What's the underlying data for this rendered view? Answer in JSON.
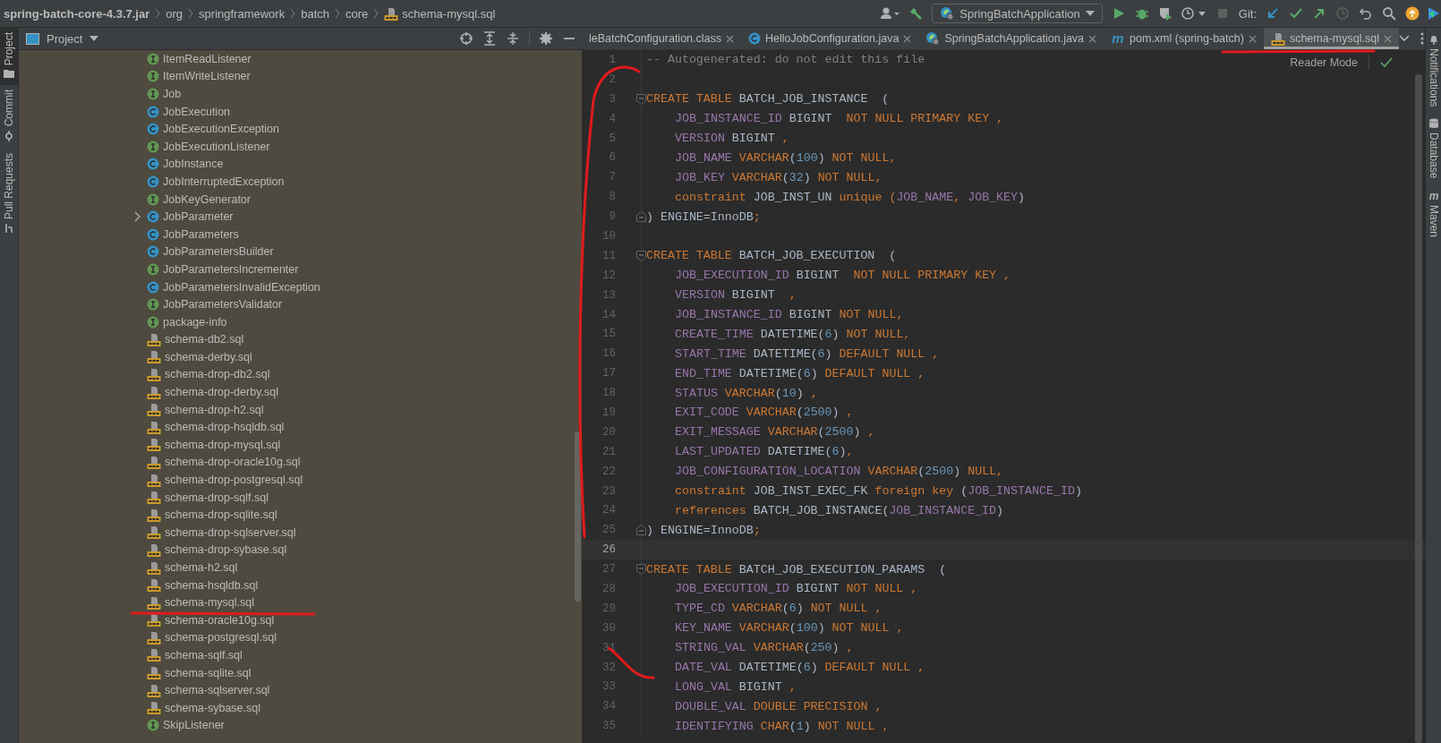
{
  "breadcrumbs": [
    {
      "label": "spring-batch-core-4.3.7.jar",
      "kind": "jar"
    },
    {
      "label": "org",
      "kind": "folder"
    },
    {
      "label": "springframework",
      "kind": "folder"
    },
    {
      "label": "batch",
      "kind": "folder"
    },
    {
      "label": "core",
      "kind": "folder"
    },
    {
      "label": "schema-mysql.sql",
      "kind": "sql"
    }
  ],
  "toolbar": {
    "run_config": "SpringBatchApplication",
    "git_label": "Git:"
  },
  "left_strip": [
    {
      "label": "Project",
      "selected": true
    },
    {
      "label": "Commit",
      "selected": false
    },
    {
      "label": "Pull Requests",
      "selected": false
    }
  ],
  "project_panel": {
    "title": "Project",
    "items": [
      {
        "label": "ItemReadListener",
        "kind": "interface",
        "expandable": false
      },
      {
        "label": "ItemWriteListener",
        "kind": "interface",
        "expandable": false
      },
      {
        "label": "Job",
        "kind": "interface",
        "expandable": false
      },
      {
        "label": "JobExecution",
        "kind": "class",
        "expandable": false
      },
      {
        "label": "JobExecutionException",
        "kind": "class",
        "expandable": false
      },
      {
        "label": "JobExecutionListener",
        "kind": "interface",
        "expandable": false
      },
      {
        "label": "JobInstance",
        "kind": "class",
        "expandable": false
      },
      {
        "label": "JobInterruptedException",
        "kind": "class",
        "expandable": false
      },
      {
        "label": "JobKeyGenerator",
        "kind": "interface",
        "expandable": false
      },
      {
        "label": "JobParameter",
        "kind": "class",
        "expandable": true
      },
      {
        "label": "JobParameters",
        "kind": "class",
        "expandable": false
      },
      {
        "label": "JobParametersBuilder",
        "kind": "class",
        "expandable": false
      },
      {
        "label": "JobParametersIncrementer",
        "kind": "interface",
        "expandable": false
      },
      {
        "label": "JobParametersInvalidException",
        "kind": "class",
        "expandable": false
      },
      {
        "label": "JobParametersValidator",
        "kind": "interface",
        "expandable": false
      },
      {
        "label": "package-info",
        "kind": "interface",
        "expandable": false
      },
      {
        "label": "schema-db2.sql",
        "kind": "sql",
        "expandable": false
      },
      {
        "label": "schema-derby.sql",
        "kind": "sql",
        "expandable": false
      },
      {
        "label": "schema-drop-db2.sql",
        "kind": "sql",
        "expandable": false
      },
      {
        "label": "schema-drop-derby.sql",
        "kind": "sql",
        "expandable": false
      },
      {
        "label": "schema-drop-h2.sql",
        "kind": "sql",
        "expandable": false
      },
      {
        "label": "schema-drop-hsqldb.sql",
        "kind": "sql",
        "expandable": false
      },
      {
        "label": "schema-drop-mysql.sql",
        "kind": "sql",
        "expandable": false
      },
      {
        "label": "schema-drop-oracle10g.sql",
        "kind": "sql",
        "expandable": false
      },
      {
        "label": "schema-drop-postgresql.sql",
        "kind": "sql",
        "expandable": false
      },
      {
        "label": "schema-drop-sqlf.sql",
        "kind": "sql",
        "expandable": false
      },
      {
        "label": "schema-drop-sqlite.sql",
        "kind": "sql",
        "expandable": false
      },
      {
        "label": "schema-drop-sqlserver.sql",
        "kind": "sql",
        "expandable": false
      },
      {
        "label": "schema-drop-sybase.sql",
        "kind": "sql",
        "expandable": false
      },
      {
        "label": "schema-h2.sql",
        "kind": "sql",
        "expandable": false
      },
      {
        "label": "schema-hsqldb.sql",
        "kind": "sql",
        "expandable": false
      },
      {
        "label": "schema-mysql.sql",
        "kind": "sql",
        "expandable": false
      },
      {
        "label": "schema-oracle10g.sql",
        "kind": "sql",
        "expandable": false
      },
      {
        "label": "schema-postgresql.sql",
        "kind": "sql",
        "expandable": false
      },
      {
        "label": "schema-sqlf.sql",
        "kind": "sql",
        "expandable": false
      },
      {
        "label": "schema-sqlite.sql",
        "kind": "sql",
        "expandable": false
      },
      {
        "label": "schema-sqlserver.sql",
        "kind": "sql",
        "expandable": false
      },
      {
        "label": "schema-sybase.sql",
        "kind": "sql",
        "expandable": false
      },
      {
        "label": "SkipListener",
        "kind": "interface",
        "expandable": false
      }
    ]
  },
  "tabs": [
    {
      "label": "leBatchConfiguration.class",
      "kind": "none",
      "selected": false
    },
    {
      "label": "HelloJobConfiguration.java",
      "kind": "class",
      "selected": false
    },
    {
      "label": "SpringBatchApplication.java",
      "kind": "spring",
      "selected": false
    },
    {
      "label": "pom.xml (spring-batch)",
      "kind": "maven",
      "badge": "m",
      "selected": false
    },
    {
      "label": "schema-mysql.sql",
      "kind": "sql",
      "selected": true
    }
  ],
  "editor": {
    "reader_mode": "Reader Mode",
    "lines": [
      {
        "number": "1",
        "current": false,
        "kind": "plain",
        "tokens": [
          {
            "text": "-- Autogenerated: do not edit this file",
            "kind": "comment"
          }
        ]
      },
      {
        "number": "2",
        "current": false,
        "kind": "plain"
      },
      {
        "number": "3",
        "current": false,
        "kind": "fold-start",
        "tokens": [
          {
            "text": "CREATE TABLE ",
            "kind": "keyword"
          },
          {
            "text": "BATCH_JOB_INSTANCE  (",
            "kind": "name"
          }
        ]
      },
      {
        "number": "4",
        "current": false,
        "kind": "field",
        "tokens": [
          {
            "text": "JOB_INSTANCE_ID",
            "kind": "column"
          },
          {
            "text": " BIGINT  ",
            "kind": "name"
          },
          {
            "text": "NOT NULL PRIMARY KEY ,",
            "kind": "keyword"
          }
        ]
      },
      {
        "number": "5",
        "current": false,
        "kind": "field",
        "tokens": [
          {
            "text": "VERSION",
            "kind": "column"
          },
          {
            "text": " BIGINT ",
            "kind": "name"
          },
          {
            "text": ",",
            "kind": "keyword"
          }
        ]
      },
      {
        "number": "6",
        "current": false,
        "kind": "field",
        "tokens": [
          {
            "text": "JOB_NAME",
            "kind": "column"
          },
          {
            "text": " VARCHAR",
            "kind": "keyword"
          },
          {
            "text": "(",
            "kind": "name"
          },
          {
            "text": "100",
            "kind": "number"
          },
          {
            "text": ") ",
            "kind": "name"
          },
          {
            "text": "NOT NULL,",
            "kind": "keyword"
          }
        ]
      },
      {
        "number": "7",
        "current": false,
        "kind": "field",
        "tokens": [
          {
            "text": "JOB_KEY",
            "kind": "column"
          },
          {
            "text": " VARCHAR",
            "kind": "keyword"
          },
          {
            "text": "(",
            "kind": "name"
          },
          {
            "text": "32",
            "kind": "number"
          },
          {
            "text": ") ",
            "kind": "name"
          },
          {
            "text": "NOT NULL,",
            "kind": "keyword"
          }
        ]
      },
      {
        "number": "8",
        "current": false,
        "kind": "field",
        "tokens": [
          {
            "text": "constraint ",
            "kind": "keyword"
          },
          {
            "text": "JOB_INST_UN ",
            "kind": "name"
          },
          {
            "text": "unique (",
            "kind": "keyword"
          },
          {
            "text": "JOB_NAME",
            "kind": "column"
          },
          {
            "text": ", ",
            "kind": "keyword"
          },
          {
            "text": "JOB_KEY",
            "kind": "column"
          },
          {
            "text": ")",
            "kind": "name"
          }
        ]
      },
      {
        "number": "9",
        "current": false,
        "kind": "fold-end",
        "tokens": [
          {
            "text": ") ENGINE=InnoDB",
            "kind": "name"
          },
          {
            "text": ";",
            "kind": "keyword"
          }
        ]
      },
      {
        "number": "10",
        "current": false,
        "kind": "plain"
      },
      {
        "number": "11",
        "current": false,
        "kind": "fold-start",
        "tokens": [
          {
            "text": "CREATE TABLE ",
            "kind": "keyword"
          },
          {
            "text": "BATCH_JOB_EXECUTION  (",
            "kind": "name"
          }
        ]
      },
      {
        "number": "12",
        "current": false,
        "kind": "field",
        "tokens": [
          {
            "text": "JOB_EXECUTION_ID",
            "kind": "column"
          },
          {
            "text": " BIGINT  ",
            "kind": "name"
          },
          {
            "text": "NOT NULL PRIMARY KEY ,",
            "kind": "keyword"
          }
        ]
      },
      {
        "number": "13",
        "current": false,
        "kind": "field",
        "tokens": [
          {
            "text": "VERSION",
            "kind": "column"
          },
          {
            "text": " BIGINT  ",
            "kind": "name"
          },
          {
            "text": ",",
            "kind": "keyword"
          }
        ]
      },
      {
        "number": "14",
        "current": false,
        "kind": "field",
        "tokens": [
          {
            "text": "JOB_INSTANCE_ID",
            "kind": "column"
          },
          {
            "text": " BIGINT ",
            "kind": "name"
          },
          {
            "text": "NOT NULL,",
            "kind": "keyword"
          }
        ]
      },
      {
        "number": "15",
        "current": false,
        "kind": "field",
        "tokens": [
          {
            "text": "CREATE_TIME",
            "kind": "column"
          },
          {
            "text": " DATETIME(",
            "kind": "name"
          },
          {
            "text": "6",
            "kind": "number"
          },
          {
            "text": ") ",
            "kind": "name"
          },
          {
            "text": "NOT NULL,",
            "kind": "keyword"
          }
        ]
      },
      {
        "number": "16",
        "current": false,
        "kind": "field",
        "tokens": [
          {
            "text": "START_TIME",
            "kind": "column"
          },
          {
            "text": " DATETIME(",
            "kind": "name"
          },
          {
            "text": "6",
            "kind": "number"
          },
          {
            "text": ") ",
            "kind": "name"
          },
          {
            "text": "DEFAULT NULL ,",
            "kind": "keyword"
          }
        ]
      },
      {
        "number": "17",
        "current": false,
        "kind": "field",
        "tokens": [
          {
            "text": "END_TIME",
            "kind": "column"
          },
          {
            "text": " DATETIME(",
            "kind": "name"
          },
          {
            "text": "6",
            "kind": "number"
          },
          {
            "text": ") ",
            "kind": "name"
          },
          {
            "text": "DEFAULT NULL ,",
            "kind": "keyword"
          }
        ]
      },
      {
        "number": "18",
        "current": false,
        "kind": "field",
        "tokens": [
          {
            "text": "STATUS",
            "kind": "column"
          },
          {
            "text": " VARCHAR",
            "kind": "keyword"
          },
          {
            "text": "(",
            "kind": "name"
          },
          {
            "text": "10",
            "kind": "number"
          },
          {
            "text": ") ",
            "kind": "name"
          },
          {
            "text": ",",
            "kind": "keyword"
          }
        ]
      },
      {
        "number": "19",
        "current": false,
        "kind": "field",
        "tokens": [
          {
            "text": "EXIT_CODE",
            "kind": "column"
          },
          {
            "text": " VARCHAR",
            "kind": "keyword"
          },
          {
            "text": "(",
            "kind": "name"
          },
          {
            "text": "2500",
            "kind": "number"
          },
          {
            "text": ") ",
            "kind": "name"
          },
          {
            "text": ",",
            "kind": "keyword"
          }
        ]
      },
      {
        "number": "20",
        "current": false,
        "kind": "field",
        "tokens": [
          {
            "text": "EXIT_MESSAGE",
            "kind": "column"
          },
          {
            "text": " VARCHAR",
            "kind": "keyword"
          },
          {
            "text": "(",
            "kind": "name"
          },
          {
            "text": "2500",
            "kind": "number"
          },
          {
            "text": ") ",
            "kind": "name"
          },
          {
            "text": ",",
            "kind": "keyword"
          }
        ]
      },
      {
        "number": "21",
        "current": false,
        "kind": "field",
        "tokens": [
          {
            "text": "LAST_UPDATED",
            "kind": "column"
          },
          {
            "text": " DATETIME(",
            "kind": "name"
          },
          {
            "text": "6",
            "kind": "number"
          },
          {
            "text": ")",
            "kind": "name"
          },
          {
            "text": ",",
            "kind": "keyword"
          }
        ]
      },
      {
        "number": "22",
        "current": false,
        "kind": "field",
        "tokens": [
          {
            "text": "JOB_CONFIGURATION_LOCATION",
            "kind": "column"
          },
          {
            "text": " VARCHAR",
            "kind": "keyword"
          },
          {
            "text": "(",
            "kind": "name"
          },
          {
            "text": "2500",
            "kind": "number"
          },
          {
            "text": ") ",
            "kind": "name"
          },
          {
            "text": "NULL,",
            "kind": "keyword"
          }
        ]
      },
      {
        "number": "23",
        "current": false,
        "kind": "field",
        "tokens": [
          {
            "text": "constraint ",
            "kind": "keyword"
          },
          {
            "text": "JOB_INST_EXEC_FK ",
            "kind": "name"
          },
          {
            "text": "foreign key ",
            "kind": "keyword"
          },
          {
            "text": "(",
            "kind": "name"
          },
          {
            "text": "JOB_INSTANCE_ID",
            "kind": "column"
          },
          {
            "text": ")",
            "kind": "name"
          }
        ]
      },
      {
        "number": "24",
        "current": false,
        "kind": "field",
        "tokens": [
          {
            "text": "references ",
            "kind": "keyword"
          },
          {
            "text": "BATCH_JOB_INSTANCE(",
            "kind": "name"
          },
          {
            "text": "JOB_INSTANCE_ID",
            "kind": "column"
          },
          {
            "text": ")",
            "kind": "name"
          }
        ]
      },
      {
        "number": "25",
        "current": false,
        "kind": "fold-end",
        "tokens": [
          {
            "text": ") ENGINE=InnoDB",
            "kind": "name"
          },
          {
            "text": ";",
            "kind": "keyword"
          }
        ]
      },
      {
        "number": "26",
        "current": true,
        "kind": "plain"
      },
      {
        "number": "27",
        "current": false,
        "kind": "fold-start",
        "tokens": [
          {
            "text": "CREATE TABLE ",
            "kind": "keyword"
          },
          {
            "text": "BATCH_JOB_EXECUTION_PARAMS  (",
            "kind": "name"
          }
        ]
      },
      {
        "number": "28",
        "current": false,
        "kind": "field",
        "tokens": [
          {
            "text": "JOB_EXECUTION_ID",
            "kind": "column"
          },
          {
            "text": " BIGINT ",
            "kind": "name"
          },
          {
            "text": "NOT NULL ,",
            "kind": "keyword"
          }
        ]
      },
      {
        "number": "29",
        "current": false,
        "kind": "field",
        "tokens": [
          {
            "text": "TYPE_CD",
            "kind": "column"
          },
          {
            "text": " VARCHAR",
            "kind": "keyword"
          },
          {
            "text": "(",
            "kind": "name"
          },
          {
            "text": "6",
            "kind": "number"
          },
          {
            "text": ") ",
            "kind": "name"
          },
          {
            "text": "NOT NULL ,",
            "kind": "keyword"
          }
        ]
      },
      {
        "number": "30",
        "current": false,
        "kind": "field",
        "tokens": [
          {
            "text": "KEY_NAME",
            "kind": "column"
          },
          {
            "text": " VARCHAR",
            "kind": "keyword"
          },
          {
            "text": "(",
            "kind": "name"
          },
          {
            "text": "100",
            "kind": "number"
          },
          {
            "text": ") ",
            "kind": "name"
          },
          {
            "text": "NOT NULL ,",
            "kind": "keyword"
          }
        ]
      },
      {
        "number": "31",
        "current": false,
        "kind": "field",
        "tokens": [
          {
            "text": "STRING_VAL",
            "kind": "column"
          },
          {
            "text": " VARCHAR",
            "kind": "keyword"
          },
          {
            "text": "(",
            "kind": "name"
          },
          {
            "text": "250",
            "kind": "number"
          },
          {
            "text": ") ",
            "kind": "name"
          },
          {
            "text": ",",
            "kind": "keyword"
          }
        ]
      },
      {
        "number": "32",
        "current": false,
        "kind": "field",
        "tokens": [
          {
            "text": "DATE_VAL",
            "kind": "column"
          },
          {
            "text": " DATETIME(",
            "kind": "name"
          },
          {
            "text": "6",
            "kind": "number"
          },
          {
            "text": ") ",
            "kind": "name"
          },
          {
            "text": "DEFAULT NULL ,",
            "kind": "keyword"
          }
        ]
      },
      {
        "number": "33",
        "current": false,
        "kind": "field",
        "tokens": [
          {
            "text": "LONG_VAL",
            "kind": "column"
          },
          {
            "text": " BIGINT ",
            "kind": "name"
          },
          {
            "text": ",",
            "kind": "keyword"
          }
        ]
      },
      {
        "number": "34",
        "current": false,
        "kind": "field",
        "tokens": [
          {
            "text": "DOUBLE_VAL",
            "kind": "column"
          },
          {
            "text": " DOUBLE PRECISION ,",
            "kind": "keyword"
          }
        ]
      },
      {
        "number": "35",
        "current": false,
        "kind": "field",
        "tokens": [
          {
            "text": "IDENTIFYING",
            "kind": "column"
          },
          {
            "text": " CHAR",
            "kind": "keyword"
          },
          {
            "text": "(",
            "kind": "name"
          },
          {
            "text": "1",
            "kind": "number"
          },
          {
            "text": ") ",
            "kind": "name"
          },
          {
            "text": "NOT NULL ,",
            "kind": "keyword"
          }
        ]
      }
    ]
  },
  "right_strip": [
    {
      "label": "Notifications"
    },
    {
      "label": "Database"
    },
    {
      "label": "Maven",
      "badge": "m"
    }
  ]
}
